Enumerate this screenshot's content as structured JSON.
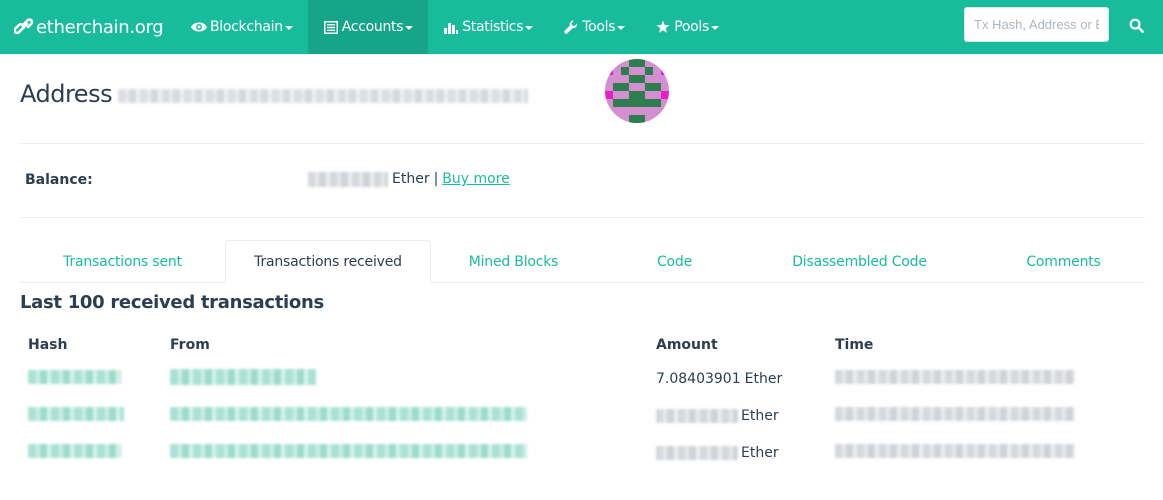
{
  "navbar": {
    "brand": "etherchain.org",
    "items": [
      {
        "label": "Blockchain",
        "icon": "eye-icon",
        "active": false
      },
      {
        "label": "Accounts",
        "icon": "list-icon",
        "active": true
      },
      {
        "label": "Statistics",
        "icon": "bar-chart-icon",
        "active": false
      },
      {
        "label": "Tools",
        "icon": "wrench-icon",
        "active": false
      },
      {
        "label": "Pools",
        "icon": "star-icon",
        "active": false
      }
    ],
    "search_placeholder": "Tx Hash, Address or Block",
    "search_icon": "search-icon"
  },
  "address": {
    "title": "Address",
    "value_redacted": true
  },
  "identicon": {
    "colors": {
      "bg": "#d48fd0",
      "fg": "#2e7d4f",
      "spot": "#e81fc9"
    }
  },
  "balance": {
    "label": "Balance:",
    "unit": "Ether",
    "separator": "|",
    "buy_more": "Buy more"
  },
  "tabs": [
    {
      "label": "Transactions sent",
      "active": false
    },
    {
      "label": "Transactions received",
      "active": true
    },
    {
      "label": "Mined Blocks",
      "active": false
    },
    {
      "label": "Code",
      "active": false
    },
    {
      "label": "Disassembled Code",
      "active": false
    },
    {
      "label": "Comments",
      "active": false
    }
  ],
  "section_title": "Last 100 received transactions",
  "table": {
    "headers": [
      "Hash",
      "From",
      "Amount",
      "Time"
    ],
    "rows": [
      {
        "hash": "",
        "from": "",
        "amount": "7.08403901",
        "unit": "Ether",
        "time": ""
      },
      {
        "hash": "",
        "from": "",
        "amount": "",
        "unit": "Ether",
        "time": ""
      },
      {
        "hash": "",
        "from": "",
        "amount": "",
        "unit": "Ether",
        "time": ""
      }
    ]
  },
  "colors": {
    "accent": "#18bc9c",
    "accent_dark": "#15a589",
    "text": "#2c3e50"
  }
}
